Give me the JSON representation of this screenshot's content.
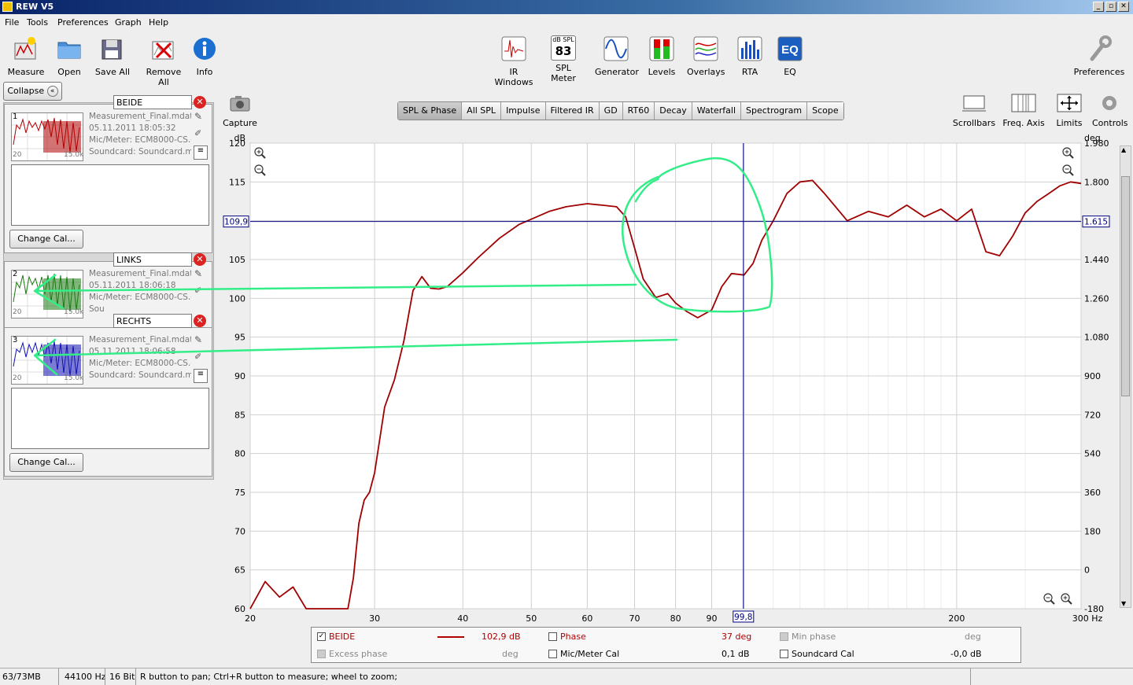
{
  "window": {
    "title": "REW V5"
  },
  "menu": [
    "File",
    "Tools",
    "Preferences",
    "Graph",
    "Help"
  ],
  "toolbar_left": [
    {
      "label": "Measure",
      "icon": "measure-icon"
    },
    {
      "label": "Open",
      "icon": "folder-icon"
    },
    {
      "label": "Save All",
      "icon": "save-icon"
    },
    {
      "label": "Remove All",
      "icon": "remove-icon"
    },
    {
      "label": "Info",
      "icon": "info-icon"
    }
  ],
  "toolbar_center": [
    {
      "label": "IR Windows",
      "icon": "ir-windows-icon"
    },
    {
      "label": "SPL Meter",
      "icon": "spl-meter-icon",
      "top": "dB SPL",
      "value": "83"
    },
    {
      "label": "Generator",
      "icon": "generator-icon"
    },
    {
      "label": "Levels",
      "icon": "levels-icon"
    },
    {
      "label": "Overlays",
      "icon": "overlays-icon"
    },
    {
      "label": "RTA",
      "icon": "rta-icon"
    },
    {
      "label": "EQ",
      "icon": "eq-icon"
    }
  ],
  "preferences_label": "Preferences",
  "graph_tools": [
    "Scrollbars",
    "Freq. Axis",
    "Limits",
    "Controls"
  ],
  "capture_label": "Capture",
  "tabs": [
    "SPL & Phase",
    "All SPL",
    "Impulse",
    "Filtered IR",
    "GD",
    "RT60",
    "Decay",
    "Waterfall",
    "Spectrogram",
    "Scope"
  ],
  "collapse_label": "Collapse",
  "measurements": [
    {
      "num": "1",
      "name": "BEIDE",
      "file": "Measurement_Final.mdat",
      "date": "05.11.2011 18:05:32",
      "mic": "Mic/Meter: ECM8000-CS.c",
      "card": "Soundcard: Soundcard.m",
      "thumb_left": "20",
      "thumb_right": "15.0k",
      "color": "#b00000"
    },
    {
      "num": "2",
      "name": "LINKS",
      "file": "Measurement_Final.mdat",
      "date": "05.11.2011 18:06:18",
      "mic": "Mic/Meter: ECM8000-CS.c",
      "card": "Sou",
      "thumb_left": "20",
      "thumb_right": "15.0k",
      "color": "#1a7a10"
    },
    {
      "num": "3",
      "name": "RECHTS",
      "file": "Measurement_Final.mdat",
      "date": "05.11.2011 18:06:58",
      "mic": "Mic/Meter: ECM8000-CS.c",
      "card": "Soundcard: Soundcard.m",
      "thumb_left": "20",
      "thumb_right": "15.0k",
      "color": "#1010b0"
    }
  ],
  "change_cal_label": "Change Cal...",
  "chart_data": {
    "type": "line",
    "xlabel": "Hz",
    "ylabel": "dB",
    "y2label": "deg",
    "xscale": "log",
    "xlim": [
      20,
      300
    ],
    "ylim": [
      60,
      120
    ],
    "y2lim": [
      -180,
      1980
    ],
    "x_ticks": [
      "20",
      "30",
      "40",
      "50",
      "60",
      "70",
      "80",
      "90",
      "200",
      "300 Hz"
    ],
    "y_ticks": [
      "120",
      "115",
      "110",
      "105",
      "100",
      "95",
      "90",
      "85",
      "80",
      "75",
      "70",
      "65",
      "60"
    ],
    "y2_ticks": [
      "1.980",
      "1.800",
      "1.615",
      "1.440",
      "1.260",
      "1.080",
      "900",
      "720",
      "540",
      "360",
      "180",
      "0",
      "-180"
    ],
    "cursor": {
      "x": 99.8,
      "y": 109.9,
      "x_label": "99,8",
      "y_label": "109,9",
      "y2_label": "1.615"
    },
    "grid": true,
    "series": [
      {
        "name": "BEIDE",
        "color": "#a00000",
        "x": [
          20,
          21,
          22,
          23,
          24,
          25,
          26,
          27,
          27.5,
          28,
          28.5,
          29,
          29.5,
          30,
          31,
          32,
          33,
          34,
          35,
          36,
          37,
          38,
          40,
          42,
          45,
          48,
          50,
          53,
          56,
          60,
          63,
          66,
          68,
          70,
          72,
          75,
          78,
          80,
          83,
          86,
          90,
          93,
          96,
          100,
          103,
          106,
          110,
          115,
          120,
          125,
          130,
          140,
          150,
          160,
          170,
          180,
          190,
          200,
          210,
          220,
          230,
          240,
          250,
          260,
          270,
          280,
          290,
          300
        ],
        "y": [
          59.5,
          63.5,
          61.5,
          62.8,
          59.5,
          58,
          57.5,
          59,
          60,
          64,
          71,
          74,
          75,
          77.5,
          86,
          89.5,
          94.5,
          101,
          102.8,
          101.3,
          101.2,
          101.5,
          103.3,
          105.2,
          107.7,
          109.5,
          110.2,
          111.2,
          111.8,
          112.2,
          112,
          111.8,
          110.5,
          106.5,
          102.5,
          100.1,
          100.6,
          99.4,
          98.3,
          97.5,
          98.5,
          101.5,
          103.2,
          103,
          104.5,
          107.5,
          110,
          113.5,
          115,
          115.2,
          113.5,
          110,
          111.2,
          110.5,
          112,
          110.5,
          111.5,
          110,
          111.5,
          106,
          105.5,
          108,
          111,
          112.5,
          113.5,
          114.5,
          115,
          114.8
        ]
      }
    ]
  },
  "legend": {
    "row1": [
      {
        "label": "BEIDE",
        "checked": true,
        "value": "102,9 dB",
        "color": "#b00000"
      },
      {
        "label": "Phase",
        "checked": false,
        "value": "37 deg",
        "color": "#b00000"
      },
      {
        "label": "Min phase",
        "checked": false,
        "value": "deg",
        "color": "#888888"
      }
    ],
    "row2": [
      {
        "label": "Excess phase",
        "checked": false,
        "value": "deg",
        "color": "#888888"
      },
      {
        "label": "Mic/Meter Cal",
        "checked": false,
        "value": "0,1 dB",
        "color": "#000000"
      },
      {
        "label": "Soundcard Cal",
        "checked": false,
        "value": "-0,0 dB",
        "color": "#000000"
      }
    ]
  },
  "status": {
    "memory": "63/73MB",
    "rate": "44100 Hz",
    "bits": "16 Bit",
    "hint": "R button to pan; Ctrl+R button to measure; wheel to zoom;"
  },
  "colors": {
    "annotation": "#33ee88",
    "cursor": "#000080",
    "trace": "#a00000"
  }
}
